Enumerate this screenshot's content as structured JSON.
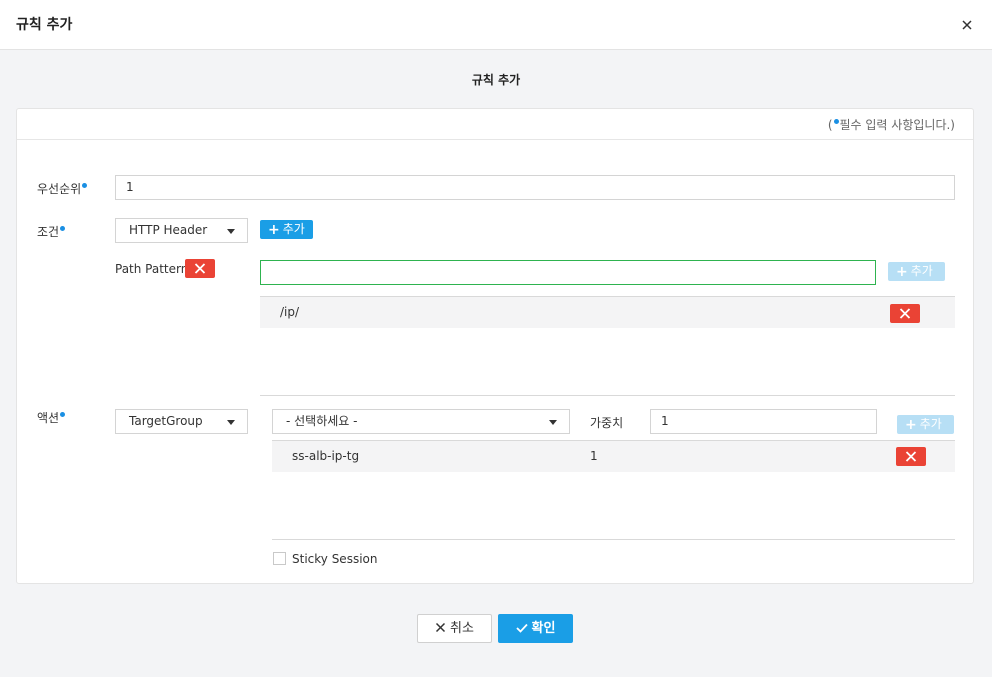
{
  "header": {
    "title": "규칙 추가"
  },
  "form_title": "규칙 추가",
  "required_note": {
    "open": "(",
    "text": "필수 입력 사항입니다.)"
  },
  "priority": {
    "label": "우선순위",
    "value": "1"
  },
  "condition": {
    "label": "조건",
    "type_selected": "HTTP Header",
    "add_label": "추가",
    "path_pattern_label": "Path Pattern",
    "pattern_input_value": "",
    "pattern_add_label": "추가",
    "patterns": [
      "/ip/"
    ]
  },
  "action": {
    "label": "액션",
    "type_selected": "TargetGroup",
    "target_select_placeholder": "- 선택하세요 -",
    "weight_label": "가중치",
    "weight_value": "1",
    "add_label": "추가",
    "targets": [
      {
        "name": "ss-alb-ip-tg",
        "weight": "1"
      }
    ],
    "sticky_session_label": "Sticky Session",
    "sticky_session_checked": false
  },
  "footer": {
    "cancel_label": "취소",
    "ok_label": "확인"
  },
  "colors": {
    "primary": "#1a9ee6",
    "danger": "#ea4335",
    "required_dot": "#1a8fe3",
    "focus_border": "#2eb34f"
  }
}
